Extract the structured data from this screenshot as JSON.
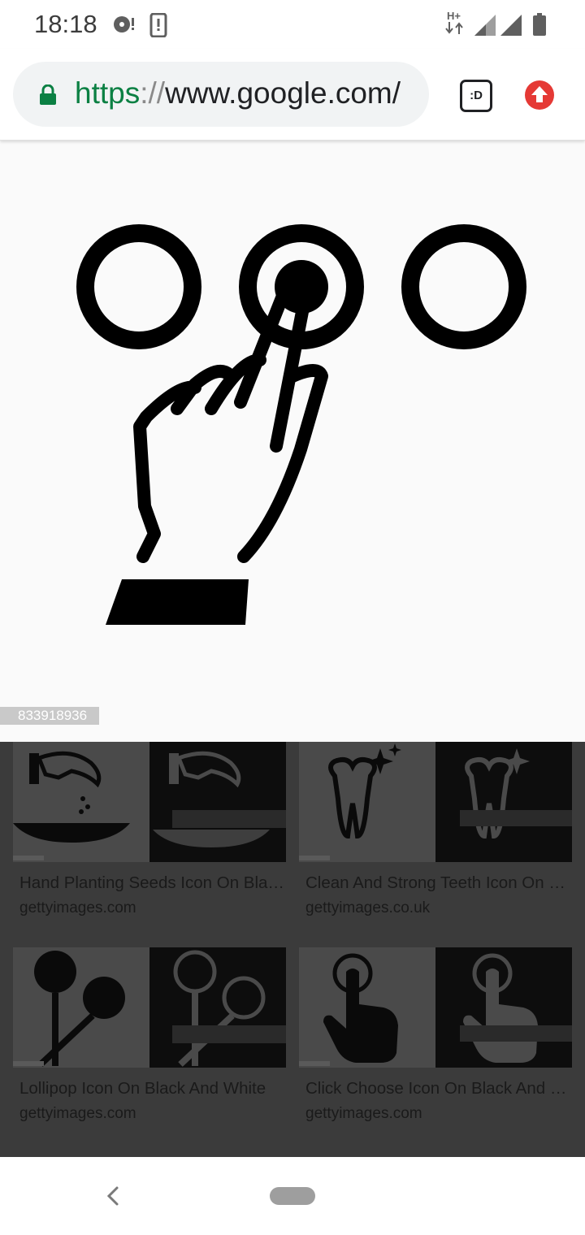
{
  "status_bar": {
    "time": "18:18",
    "network_label": "H+",
    "icons": [
      "sync-icon",
      "alert-icon",
      "data-transfer-icon",
      "signal-icon",
      "signal-icon",
      "battery-icon"
    ]
  },
  "browser": {
    "url_scheme": "https",
    "url_separator": "://",
    "url_host": "www.google.com/",
    "tab_label": ":D",
    "icons": [
      "lock-icon",
      "tab-switcher-icon",
      "update-icon"
    ],
    "colors": {
      "scheme": "#0b8043",
      "lock": "#0b8043",
      "update": "#e53935"
    }
  },
  "viewer": {
    "image_id": "833918936",
    "image_description_icon": "hand-pressing-button-icon"
  },
  "results": [
    {
      "title": "Hand Planting Seeds Icon On Black And White",
      "source": "gettyimages.com",
      "icon": "hand-seeds-icon"
    },
    {
      "title": "Clean And Strong Teeth Icon On Black And White",
      "source": "gettyimages.co.uk",
      "icon": "tooth-icon"
    },
    {
      "title": "Lollipop Icon On Black And White",
      "source": "gettyimages.com",
      "icon": "lollipop-icon"
    },
    {
      "title": "Click Choose Icon On Black And White",
      "source": "gettyimages.com",
      "icon": "pointing-hand-icon"
    }
  ],
  "nav_bar": {
    "icons": [
      "back-icon",
      "home-pill-icon"
    ]
  }
}
